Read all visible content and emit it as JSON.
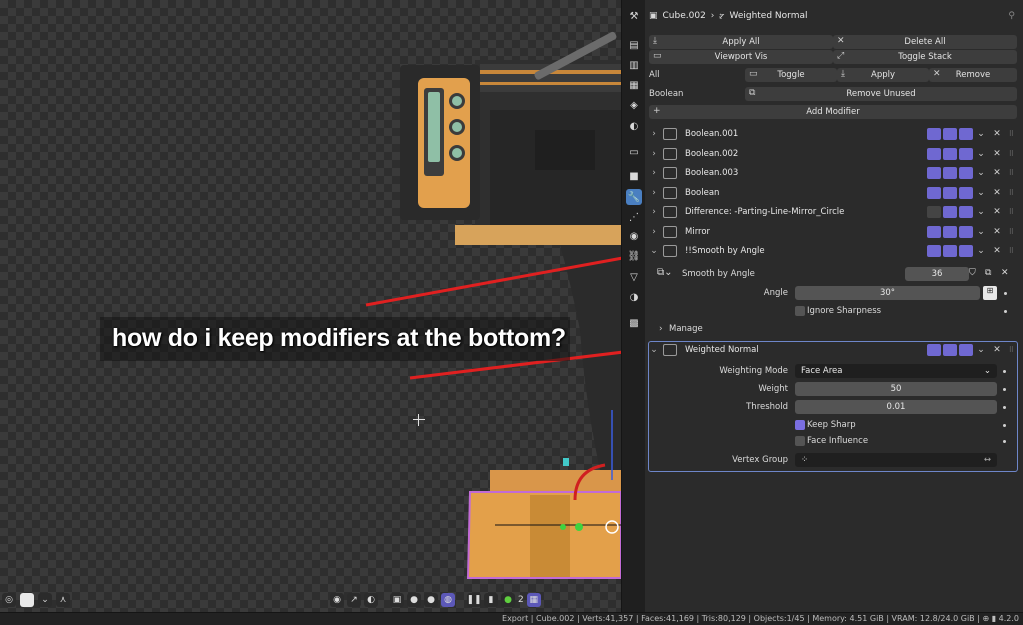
{
  "question": "how do i keep modifiers at the bottom?",
  "panel": {
    "object_name": "Cube.002",
    "modifier_name": "Weighted Normal",
    "apply_all": "Apply All",
    "delete_all": "Delete All",
    "viewport_vis": "Viewport Vis",
    "toggle_stack": "Toggle Stack",
    "all_label": "All",
    "toggle": "Toggle",
    "apply": "Apply",
    "remove": "Remove",
    "boolean_label": "Boolean",
    "remove_unused": "Remove Unused",
    "add_modifier": "Add Modifier"
  },
  "modifiers": [
    {
      "name": "Boolean.001"
    },
    {
      "name": "Boolean.002"
    },
    {
      "name": "Boolean.003"
    },
    {
      "name": "Boolean"
    },
    {
      "name": "Difference: -Parting-Line-Mirror_Circle"
    },
    {
      "name": "Mirror"
    },
    {
      "name": "!!Smooth by Angle"
    }
  ],
  "smooth": {
    "node_name": "Smooth by Angle",
    "users": "36",
    "angle_label": "Angle",
    "angle_value": "30°",
    "ignore_sharpness": "Ignore Sharpness",
    "manage": "Manage"
  },
  "weighted": {
    "name": "Weighted Normal",
    "mode_label": "Weighting Mode",
    "mode_value": "Face Area",
    "weight_label": "Weight",
    "weight_value": "50",
    "threshold_label": "Threshold",
    "threshold_value": "0.01",
    "keep_sharp": "Keep Sharp",
    "face_influence": "Face Influence",
    "vertex_group_label": "Vertex Group"
  },
  "viewport": {
    "count": "2"
  },
  "status": {
    "text": "Export | Cube.002 | Verts:41,357 | Faces:41,169 | Tris:80,129 | Objects:1/45 | Memory: 4.51 GiB | VRAM: 12.8/24.0 GiB | ",
    "version": "4.2.0"
  },
  "colors": {
    "accent": "#6f68d1",
    "active_tab": "#4a7fc1",
    "arrow": "#e02020",
    "model_orange": "#e3a04a"
  },
  "icons": [
    "wrench-icon",
    "camera-icon",
    "eye-icon",
    "monitor-icon",
    "x-icon",
    "chevron-down-icon",
    "chevron-right-icon",
    "drag-handle-icon"
  ]
}
